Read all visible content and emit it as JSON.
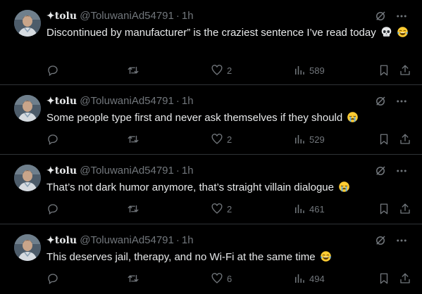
{
  "colors": {
    "background": "#000000",
    "text": "#e7e9ea",
    "muted": "#71767b",
    "divider": "#2f3336"
  },
  "tweets": [
    {
      "name": "✦tolu",
      "handle": "@ToluwaniAd54791",
      "separator": "·",
      "time": "1h",
      "text": "Discontinued by manufacturer” is the craziest sentence I’ve read today",
      "emojis": [
        "skull",
        "joy"
      ],
      "likes": "2",
      "views": "589"
    },
    {
      "name": "✦tolu",
      "handle": "@ToluwaniAd54791",
      "separator": "·",
      "time": "1h",
      "text": "Some people type first and never ask themselves if they should",
      "emojis": [
        "sob"
      ],
      "likes": "2",
      "views": "529"
    },
    {
      "name": "✦tolu",
      "handle": "@ToluwaniAd54791",
      "separator": "·",
      "time": "1h",
      "text": "That’s not dark humor anymore, that’s straight villain dialogue",
      "emojis": [
        "sob"
      ],
      "likes": "2",
      "views": "461"
    },
    {
      "name": "✦tolu",
      "handle": "@ToluwaniAd54791",
      "separator": "·",
      "time": "1h",
      "text": "This deserves jail, therapy, and no Wi-Fi at the same time",
      "emojis": [
        "joy"
      ],
      "likes": "6",
      "views": "494"
    }
  ],
  "icons": {
    "reply": "reply-icon",
    "retweet": "retweet-icon",
    "like": "heart-icon",
    "views": "views-chart-icon",
    "bookmark": "bookmark-icon",
    "share": "share-icon",
    "grok": "grok-icon",
    "more": "more-icon"
  }
}
